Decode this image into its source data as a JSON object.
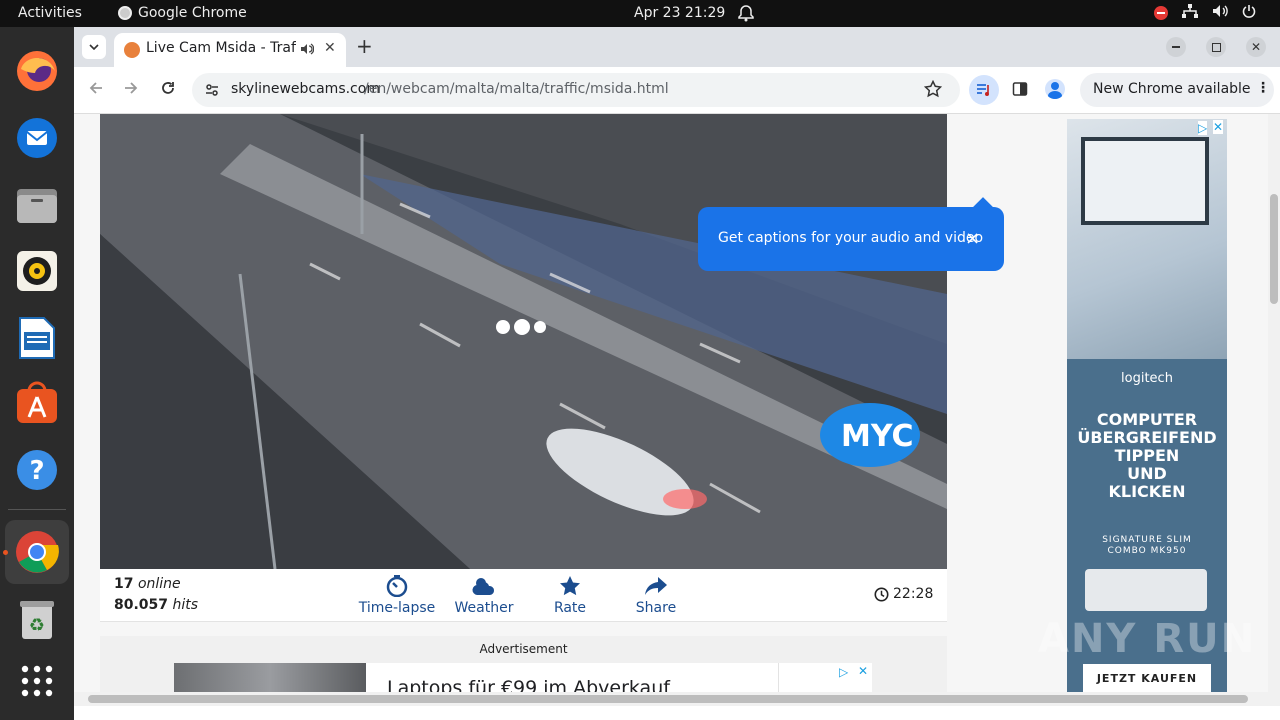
{
  "system": {
    "activities": "Activities",
    "app_name": "Google Chrome",
    "clock": "Apr 23  21:29"
  },
  "tab": {
    "title": "Live Cam Msida - Traffi"
  },
  "omnibox": {
    "domain": "skylinewebcams.com",
    "path": "/en/webcam/malta/malta/traffic/msida.html"
  },
  "toolbar": {
    "update_label": "New Chrome available"
  },
  "popup": {
    "text": "Get captions for your audio and video",
    "close": "×"
  },
  "cam": {
    "logo": "MYC"
  },
  "stats": {
    "online_count": "17",
    "online_label": "online",
    "hits_count": "80.057",
    "hits_label": "hits",
    "controls": [
      "Time-lapse",
      "Weather",
      "Rate",
      "Share"
    ],
    "time": "22:28"
  },
  "advert": {
    "heading": "Advertisement",
    "headline": "Laptops für €99 im Abverkauf"
  },
  "sidead": {
    "brand": "logitech",
    "headline": [
      "COMPUTER",
      "ÜBERGREIFEND",
      "TIPPEN",
      "UND",
      "KLICKEN"
    ],
    "product": [
      "SIGNATURE SLIM",
      "COMBO MK950"
    ],
    "cta": "JETZT KAUFEN"
  },
  "watermark": "ANY RUN",
  "colors": {
    "accent": "#1a73e8",
    "link_blue": "#1c4d8f",
    "myc": "#1e88e5"
  }
}
